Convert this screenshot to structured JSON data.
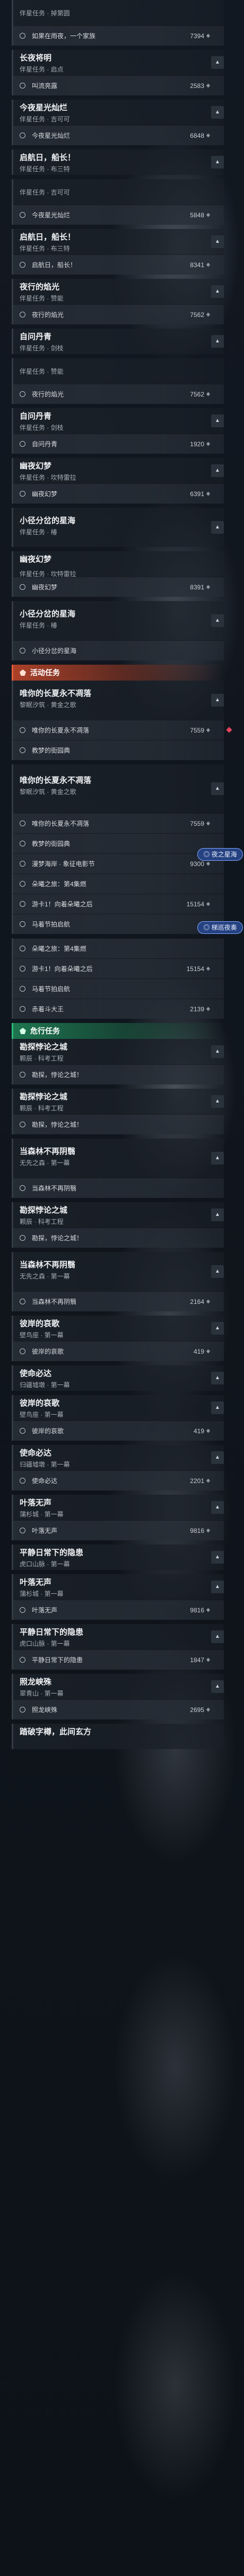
{
  "rows": [
    {
      "kind": "quest",
      "variant": "sub",
      "title": "",
      "sub": "伴星任务 · 掉第圆",
      "chev": false
    },
    {
      "kind": "step",
      "text": "如果在雨夜，一个家族",
      "reward": "7394"
    },
    {
      "kind": "gap"
    },
    {
      "kind": "quest",
      "title": "长夜将明",
      "sub": "伴星任务 · 启点",
      "chev": true
    },
    {
      "kind": "step",
      "text": "叫流亮露",
      "reward": "2583"
    },
    {
      "kind": "gap"
    },
    {
      "kind": "quest",
      "title": "今夜星光灿烂",
      "sub": "伴星任务 · 吉可可",
      "chev": true
    },
    {
      "kind": "step",
      "text": "今夜星光灿烂",
      "reward": "6848"
    },
    {
      "kind": "gap"
    },
    {
      "kind": "quest",
      "title": "启航日，船长！",
      "sub": "伴星任务 · 布三特",
      "chev": true
    },
    {
      "kind": "gap"
    },
    {
      "kind": "quest",
      "variant": "sub",
      "title": "",
      "sub": "伴星任务 · 吉可可",
      "chev": false
    },
    {
      "kind": "step",
      "text": "今夜星光灿烂",
      "reward": "5848"
    },
    {
      "kind": "gap"
    },
    {
      "kind": "quest",
      "title": "启航日，船长！",
      "sub": "伴星任务 · 布三特",
      "chev": true
    },
    {
      "kind": "step",
      "text": "启航日，船长！",
      "reward": "8341"
    },
    {
      "kind": "gap"
    },
    {
      "kind": "quest",
      "title": "夜行的焰光",
      "sub": "伴星任务 · 赞能",
      "chev": true
    },
    {
      "kind": "step",
      "text": "夜行的焰光",
      "reward": "7562"
    },
    {
      "kind": "gap"
    },
    {
      "kind": "quest",
      "title": "自问丹青",
      "sub": "伴星任务 · 剑枝",
      "chev": true
    },
    {
      "kind": "gap"
    },
    {
      "kind": "quest",
      "variant": "sub",
      "title": "",
      "sub": "伴星任务 · 赞能",
      "chev": false
    },
    {
      "kind": "step",
      "text": "夜行的焰光",
      "reward": "7562"
    },
    {
      "kind": "gap"
    },
    {
      "kind": "quest",
      "title": "自问丹青",
      "sub": "伴星任务 · 剑枝",
      "chev": true
    },
    {
      "kind": "step",
      "text": "自问丹青",
      "reward": "1920"
    },
    {
      "kind": "gap"
    },
    {
      "kind": "quest",
      "title": "幽夜幻梦",
      "sub": "伴星任务 · 坎特雷拉",
      "chev": true
    },
    {
      "kind": "step",
      "text": "幽夜幻梦",
      "reward": "6391"
    },
    {
      "kind": "gap"
    },
    {
      "kind": "quest",
      "variant": "tall",
      "title": "小径分岔的星海",
      "sub": "伴星任务 · 椿",
      "chev": true
    },
    {
      "kind": "gap"
    },
    {
      "kind": "quest",
      "variant": "sub",
      "title": "幽夜幻梦",
      "sub": "伴星任务 · 坎特雷拉",
      "chev": false
    },
    {
      "kind": "step",
      "text": "幽夜幻梦",
      "reward": "8391"
    },
    {
      "kind": "gap"
    },
    {
      "kind": "quest",
      "variant": "tall",
      "title": "小径分岔的星海",
      "sub": "伴星任务 · 椿",
      "chev": true
    },
    {
      "kind": "step",
      "text": "小径分岔的星海",
      "reward": ""
    },
    {
      "kind": "gap"
    },
    {
      "kind": "section",
      "label": "活动任务",
      "color": "orange"
    },
    {
      "kind": "quest",
      "variant": "tall",
      "title": "唯你的长夏永不凋落",
      "sub": "黎眠汐筑 · 黄金之歌",
      "chev": true
    },
    {
      "kind": "step",
      "text": "唯你的长夏永不凋落",
      "reward": "7559",
      "dot": true
    },
    {
      "kind": "step",
      "text": "教梦的街园典",
      "reward": ""
    },
    {
      "kind": "gap"
    },
    {
      "kind": "quest",
      "variant": "big",
      "title": "唯你的长夏永不凋落",
      "sub": "黎眠汐筑 · 黄金之歌",
      "chev": true
    },
    {
      "kind": "step",
      "text": "唯你的长夏永不凋落",
      "reward": "7559"
    },
    {
      "kind": "step",
      "text": "教梦的街园典",
      "reward": ""
    },
    {
      "kind": "step",
      "text": "漫梦海岸 · 象征电影节",
      "reward": "9300"
    },
    {
      "kind": "step",
      "text": "朵曦之旅：第4集燃",
      "reward": ""
    },
    {
      "kind": "step",
      "text": "游卡1！向着朵曦之后",
      "reward": "15154"
    },
    {
      "kind": "step",
      "text": "马着节拍启航",
      "reward": ""
    },
    {
      "kind": "gap"
    },
    {
      "kind": "step",
      "text": "朵曦之旅：第4集燃",
      "reward": ""
    },
    {
      "kind": "step",
      "text": "游卡1！向着朵曦之后",
      "reward": "15154"
    },
    {
      "kind": "step",
      "text": "马着节拍启航",
      "reward": ""
    },
    {
      "kind": "step",
      "text": "赤着斗大王",
      "reward": "2139"
    },
    {
      "kind": "gap"
    },
    {
      "kind": "section",
      "label": "危行任务",
      "color": "green"
    },
    {
      "kind": "quest",
      "title": "勘探悖论之城",
      "sub": "颗辰 · 科考工程",
      "chev": true
    },
    {
      "kind": "step",
      "text": "勘探，悖论之城！",
      "reward": ""
    },
    {
      "kind": "gap"
    },
    {
      "kind": "quest",
      "title": "勘探悖论之城",
      "sub": "颗辰 · 科考工程",
      "chev": true
    },
    {
      "kind": "step",
      "text": "勘探，悖论之城！",
      "reward": ""
    },
    {
      "kind": "gap"
    },
    {
      "kind": "quest",
      "variant": "tall",
      "title": "当森林不再阴翳",
      "sub": "无先之森 · 第一幕",
      "chev": true
    },
    {
      "kind": "step",
      "text": "当森林不再阴翳",
      "reward": ""
    },
    {
      "kind": "gap"
    },
    {
      "kind": "quest",
      "title": "勘探悖论之城",
      "sub": "颗辰 · 科考工程",
      "chev": true
    },
    {
      "kind": "step",
      "text": "勘探，悖论之城！",
      "reward": ""
    },
    {
      "kind": "gap"
    },
    {
      "kind": "quest",
      "variant": "tall",
      "title": "当森林不再阴翳",
      "sub": "无先之森 · 第一幕",
      "chev": true
    },
    {
      "kind": "step",
      "text": "当森林不再阴翳",
      "reward": "2164"
    },
    {
      "kind": "gap"
    },
    {
      "kind": "quest",
      "title": "彼岸的哀歌",
      "sub": "壁鸟座 · 第一幕",
      "chev": true
    },
    {
      "kind": "step",
      "text": "彼岸的哀歌",
      "reward": "419"
    },
    {
      "kind": "gap"
    },
    {
      "kind": "quest",
      "title": "使命必达",
      "sub": "归疆墟墩 · 第一幕",
      "chev": true
    },
    {
      "kind": "gap"
    },
    {
      "kind": "quest",
      "title": "彼岸的哀歌",
      "sub": "壁鸟座 · 第一幕",
      "chev": true
    },
    {
      "kind": "step",
      "text": "彼岸的哀歌",
      "reward": "419"
    },
    {
      "kind": "gap"
    },
    {
      "kind": "quest",
      "title": "使命必达",
      "sub": "归疆墟墩 · 第一幕",
      "chev": true
    },
    {
      "kind": "step",
      "text": "使命必达",
      "reward": "2201"
    },
    {
      "kind": "gap"
    },
    {
      "kind": "quest",
      "title": "叶落无声",
      "sub": "蒲杉城 · 第一幕",
      "chev": true
    },
    {
      "kind": "step",
      "text": "叶落无声",
      "reward": "9816"
    },
    {
      "kind": "gap"
    },
    {
      "kind": "quest",
      "title": "平静日常下的隐患",
      "sub": "虎口山脉 · 第一幕",
      "chev": true
    },
    {
      "kind": "gap"
    },
    {
      "kind": "quest",
      "title": "叶落无声",
      "sub": "蒲杉城 · 第一幕",
      "chev": true
    },
    {
      "kind": "step",
      "text": "叶落无声",
      "reward": "9816"
    },
    {
      "kind": "gap"
    },
    {
      "kind": "quest",
      "title": "平静日常下的隐患",
      "sub": "虎口山脉 · 第一幕",
      "chev": true
    },
    {
      "kind": "step",
      "text": "平静日常下的隐患",
      "reward": "1847"
    },
    {
      "kind": "gap"
    },
    {
      "kind": "quest",
      "title": "照龙峡殊",
      "sub": "翠青山 · 第一幕",
      "chev": true
    },
    {
      "kind": "step",
      "text": "照龙峡殊",
      "reward": "2695"
    },
    {
      "kind": "gap"
    },
    {
      "kind": "quest",
      "title": "踏破字樽，此间玄方",
      "sub": "",
      "chev": false
    }
  ],
  "badges": [
    {
      "label": "◎ 夜之星海",
      "row": "after-9300"
    },
    {
      "label": "◎ 梯巡夜奏",
      "row": "after-15154-a"
    }
  ]
}
